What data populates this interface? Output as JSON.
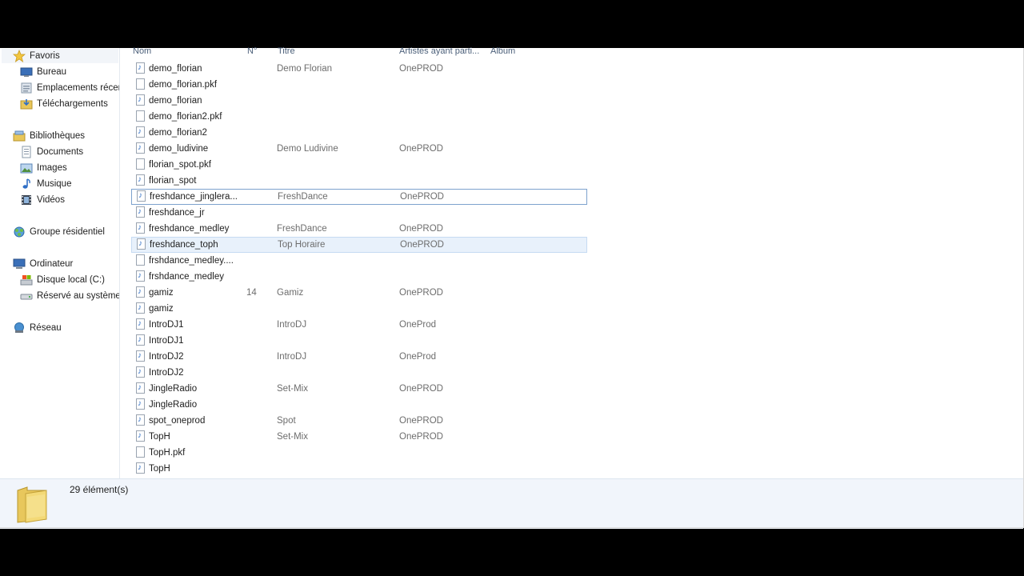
{
  "columns": {
    "name": "Nom",
    "number": "N°",
    "title": "Titre",
    "artists": "Artistes ayant parti...",
    "album": "Album"
  },
  "nav": {
    "favorites": {
      "label": "Favoris",
      "items": [
        "Bureau",
        "Emplacements récents",
        "Téléchargements"
      ]
    },
    "libraries": {
      "label": "Bibliothèques",
      "items": [
        "Documents",
        "Images",
        "Musique",
        "Vidéos"
      ]
    },
    "homegroup": {
      "label": "Groupe résidentiel"
    },
    "computer": {
      "label": "Ordinateur",
      "items": [
        "Disque local (C:)",
        "Réservé au système"
      ]
    },
    "network": {
      "label": "Réseau"
    }
  },
  "files": [
    {
      "name": "demo_florian",
      "num": "",
      "title": "Demo Florian",
      "artist": "OnePROD",
      "icon": "audio-file-icon"
    },
    {
      "name": "demo_florian.pkf",
      "num": "",
      "title": "",
      "artist": "",
      "icon": "blank-file-icon"
    },
    {
      "name": "demo_florian",
      "num": "",
      "title": "",
      "artist": "",
      "icon": "audio-file-icon"
    },
    {
      "name": "demo_florian2.pkf",
      "num": "",
      "title": "",
      "artist": "",
      "icon": "blank-file-icon"
    },
    {
      "name": "demo_florian2",
      "num": "",
      "title": "",
      "artist": "",
      "icon": "audio-file-icon"
    },
    {
      "name": "demo_ludivine",
      "num": "",
      "title": "Demo Ludivine",
      "artist": "OnePROD",
      "icon": "audio-file-icon"
    },
    {
      "name": "florian_spot.pkf",
      "num": "",
      "title": "",
      "artist": "",
      "icon": "blank-file-icon"
    },
    {
      "name": "florian_spot",
      "num": "",
      "title": "",
      "artist": "",
      "icon": "audio-file-icon"
    },
    {
      "name": "freshdance_jinglera...",
      "num": "",
      "title": "FreshDance",
      "artist": "OnePROD",
      "icon": "audio-file-icon"
    },
    {
      "name": "freshdance_jr",
      "num": "",
      "title": "",
      "artist": "",
      "icon": "audio-file-icon"
    },
    {
      "name": "freshdance_medley",
      "num": "",
      "title": "FreshDance",
      "artist": "OnePROD",
      "icon": "audio-file-icon"
    },
    {
      "name": "freshdance_toph",
      "num": "",
      "title": "Top Horaire",
      "artist": "OnePROD",
      "icon": "audio-file-icon"
    },
    {
      "name": "frshdance_medley....",
      "num": "",
      "title": "",
      "artist": "",
      "icon": "blank-file-icon"
    },
    {
      "name": "frshdance_medley",
      "num": "",
      "title": "",
      "artist": "",
      "icon": "audio-file-icon"
    },
    {
      "name": "gamiz",
      "num": "14",
      "title": "Gamiz",
      "artist": "OnePROD",
      "icon": "audio-file-icon"
    },
    {
      "name": "gamiz",
      "num": "",
      "title": "",
      "artist": "",
      "icon": "audio-file-icon"
    },
    {
      "name": "IntroDJ1",
      "num": "",
      "title": "IntroDJ",
      "artist": "OneProd",
      "icon": "audio-file-icon"
    },
    {
      "name": "IntroDJ1",
      "num": "",
      "title": "",
      "artist": "",
      "icon": "audio-file-icon"
    },
    {
      "name": "IntroDJ2",
      "num": "",
      "title": "IntroDJ",
      "artist": "OneProd",
      "icon": "audio-file-icon"
    },
    {
      "name": "IntroDJ2",
      "num": "",
      "title": "",
      "artist": "",
      "icon": "audio-file-icon"
    },
    {
      "name": "JingleRadio",
      "num": "",
      "title": "Set-Mix",
      "artist": "OnePROD",
      "icon": "audio-file-icon"
    },
    {
      "name": "JingleRadio",
      "num": "",
      "title": "",
      "artist": "",
      "icon": "audio-file-icon"
    },
    {
      "name": "spot_oneprod",
      "num": "",
      "title": "Spot",
      "artist": "OnePROD",
      "icon": "audio-file-icon"
    },
    {
      "name": "TopH",
      "num": "",
      "title": "Set-Mix",
      "artist": "OnePROD",
      "icon": "audio-file-icon"
    },
    {
      "name": "TopH.pkf",
      "num": "",
      "title": "",
      "artist": "",
      "icon": "blank-file-icon"
    },
    {
      "name": "TopH",
      "num": "",
      "title": "",
      "artist": "",
      "icon": "audio-file-icon"
    }
  ],
  "focused_index": 8,
  "hover_index": 11,
  "status": {
    "count_text": "29 élément(s)"
  },
  "colors": {
    "header_text": "#4c607a",
    "hover_bg": "#e8f1fb",
    "focus_border": "#7da2ce",
    "details_bg": "#f1f5fb",
    "note_blue": "#2f6fc6"
  }
}
